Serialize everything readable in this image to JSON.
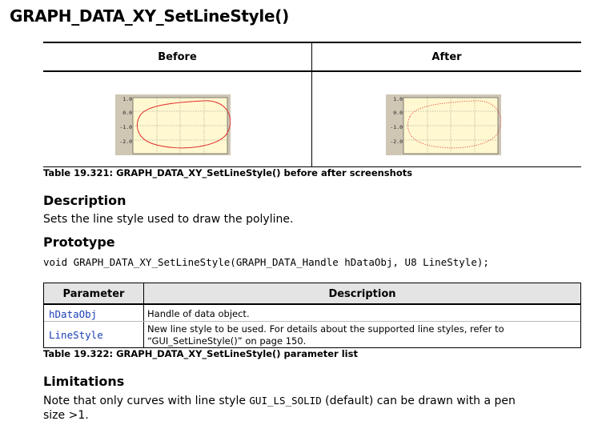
{
  "page_title": "GRAPH_DATA_XY_SetLineStyle()",
  "screenshot_table": {
    "headers": [
      "Before",
      "After"
    ],
    "graph_labels": [
      "1.0",
      "0.0",
      "-1.0",
      "-2.0"
    ],
    "caption": "Table 19.321: GRAPH_DATA_XY_SetLineStyle() before after screenshots"
  },
  "description": {
    "heading": "Description",
    "text": "Sets the line style used to draw the polyline."
  },
  "prototype": {
    "heading": "Prototype",
    "code": "void GRAPH_DATA_XY_SetLineStyle(GRAPH_DATA_Handle hDataObj, U8 LineStyle);"
  },
  "param_table": {
    "headers": [
      "Parameter",
      "Description"
    ],
    "rows": [
      {
        "name": "hDataObj",
        "desc": "Handle of data object."
      },
      {
        "name": "LineStyle",
        "desc_line1": "New line style to be used. For details about the supported line styles, refer to",
        "desc_line2": "“GUI_SetLineStyle()” on page 150."
      }
    ],
    "caption": "Table 19.322: GRAPH_DATA_XY_SetLineStyle() parameter list"
  },
  "limitations": {
    "heading": "Limitations",
    "text_before": "Note that only curves with line style ",
    "code": "GUI_LS_SOLID",
    "text_after": " (default) can be drawn with a pen",
    "text_line2": "size >1."
  },
  "colors": {
    "graph_bg": "#fff8d0",
    "graph_axis_bg": "#cfc7b4",
    "curve": "#e03030",
    "param_name": "#1a3fb5"
  }
}
